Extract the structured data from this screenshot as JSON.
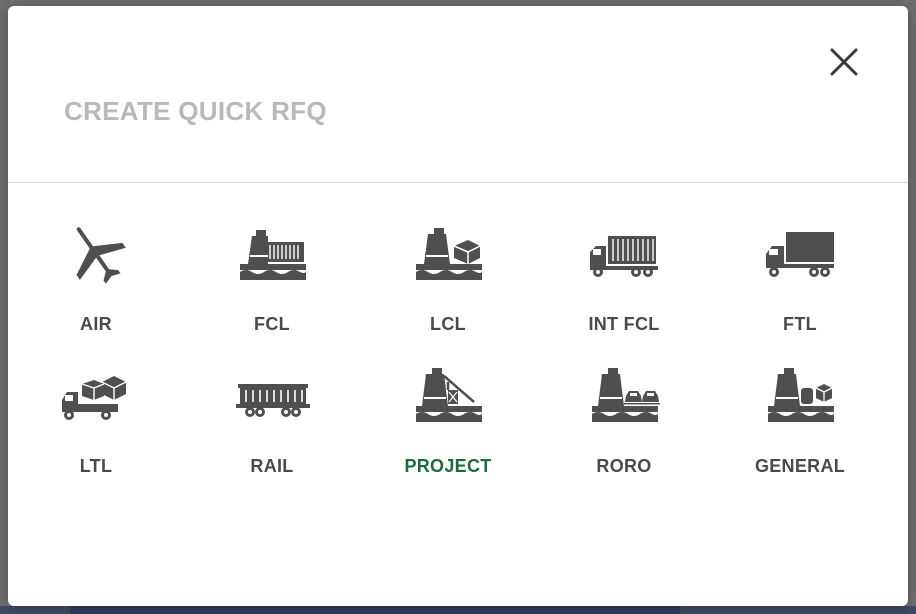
{
  "modal": {
    "title": "CREATE QUICK RFQ",
    "close_icon": "close-icon"
  },
  "options": [
    {
      "label": "AIR",
      "icon": "airplane-icon"
    },
    {
      "label": "FCL",
      "icon": "ship-container-icon"
    },
    {
      "label": "LCL",
      "icon": "ship-box-icon"
    },
    {
      "label": "INT FCL",
      "icon": "container-truck-icon"
    },
    {
      "label": "FTL",
      "icon": "truck-icon"
    },
    {
      "label": "LTL",
      "icon": "truck-boxes-icon"
    },
    {
      "label": "RAIL",
      "icon": "railcar-icon"
    },
    {
      "label": "PROJECT",
      "icon": "ship-crane-icon",
      "active": true
    },
    {
      "label": "RORO",
      "icon": "ship-cars-icon"
    },
    {
      "label": "GENERAL",
      "icon": "ship-cargo-icon"
    }
  ],
  "colors": {
    "icon": "#4f4f4f",
    "label": "#4a4a4a",
    "active_label": "#1d6b3c",
    "title": "#b9b9b9"
  }
}
